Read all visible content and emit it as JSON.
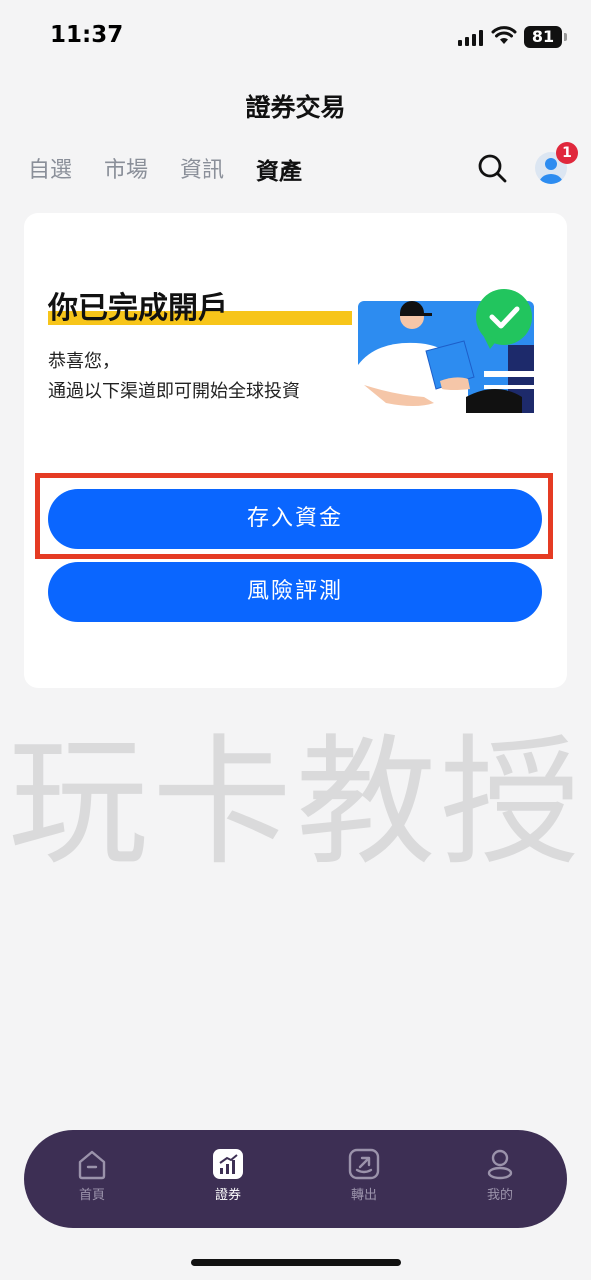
{
  "status_bar": {
    "time": "11:37",
    "battery": "81"
  },
  "header": {
    "title": "證券交易"
  },
  "tabs": [
    {
      "label": "自選"
    },
    {
      "label": "市場"
    },
    {
      "label": "資訊"
    },
    {
      "label": "資產",
      "active": true
    }
  ],
  "header_icons": {
    "search": "search-icon",
    "avatar": "avatar-icon",
    "badge_count": "1"
  },
  "card": {
    "title": "你已完成開戶",
    "desc_line1": "恭喜您，",
    "desc_line2": "通過以下渠道即可開始全球投資",
    "deposit_button": "存入資金",
    "risk_button": "風險評測"
  },
  "watermark": "玩卡教授",
  "tabbar": [
    {
      "label": "首頁",
      "icon": "home-icon"
    },
    {
      "label": "證券",
      "icon": "securities-icon",
      "active": true
    },
    {
      "label": "轉出",
      "icon": "transfer-out-icon"
    },
    {
      "label": "我的",
      "icon": "profile-icon"
    }
  ],
  "colors": {
    "primary": "#0a66ff",
    "highlight": "#e53b23",
    "accent_yellow": "#f7c51a",
    "tabbar_bg": "#3d2f54",
    "badge": "#e0283c"
  }
}
